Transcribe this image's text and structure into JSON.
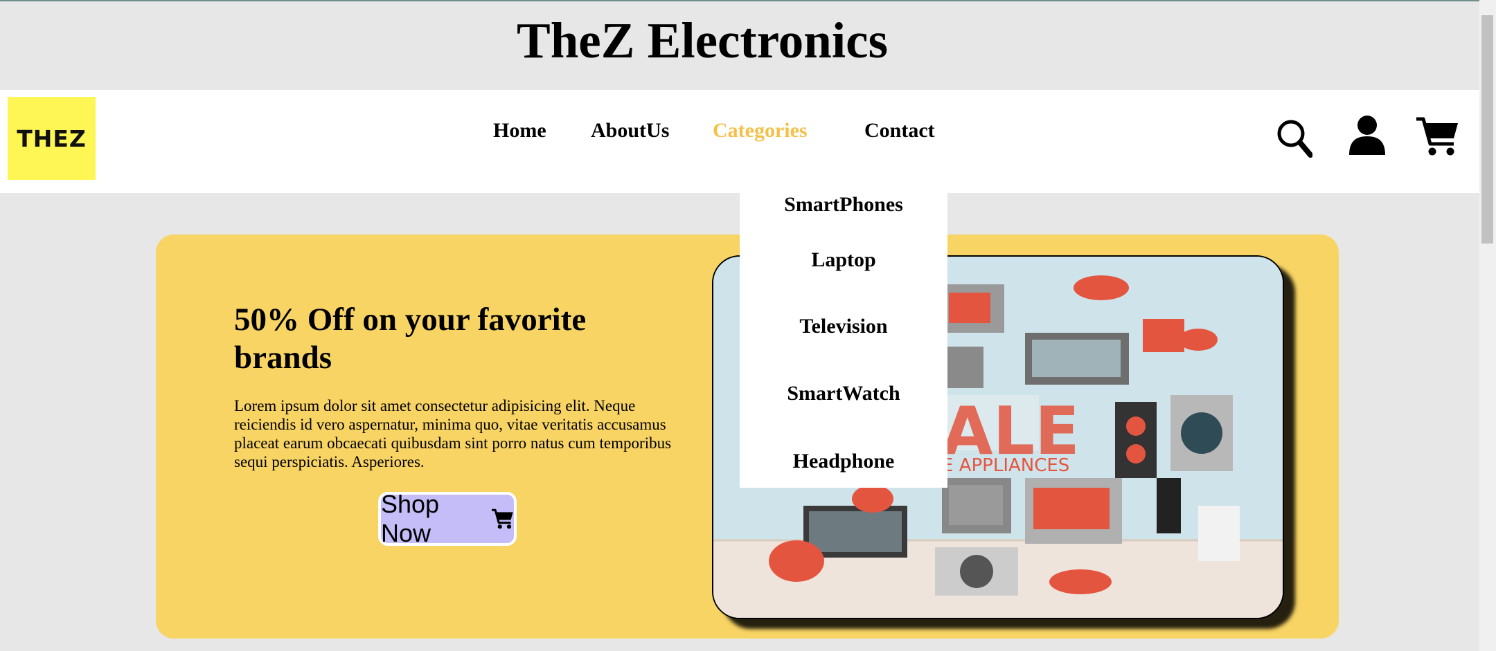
{
  "header": {
    "title": "TheZ Electronics"
  },
  "navbar": {
    "logo_text": "THEZ",
    "links": [
      "Home",
      "AboutUs",
      "Categories",
      "Contact"
    ],
    "active_link": "Categories",
    "icons": [
      "search-icon",
      "user-icon",
      "cart-icon"
    ]
  },
  "categories_dropdown": {
    "items": [
      "SmartPhones",
      "Laptop",
      "Television",
      "SmartWatch",
      "Headphone"
    ]
  },
  "hero": {
    "title": "50% Off on your favorite brands",
    "text": "Lorem ipsum dolor sit amet consectetur adipisicing elit. Neque reiciendis id vero aspernatur, minima quo, vitae veritatis accusamus placeat earum obcaecati quibusdam sint porro natus cum temporibus sequi perspiciatis. Asperiores.",
    "button_label": "Shop Now",
    "promo_image": {
      "sale_text": "ALE",
      "caption": "E APPLIANCES"
    }
  },
  "colors": {
    "page_bg": "#e7e7e7",
    "logo_bg": "#fdf655",
    "hero_bg": "#f8d464",
    "active_nav": "#f5c04a",
    "button_bg": "#c4bdf8"
  }
}
